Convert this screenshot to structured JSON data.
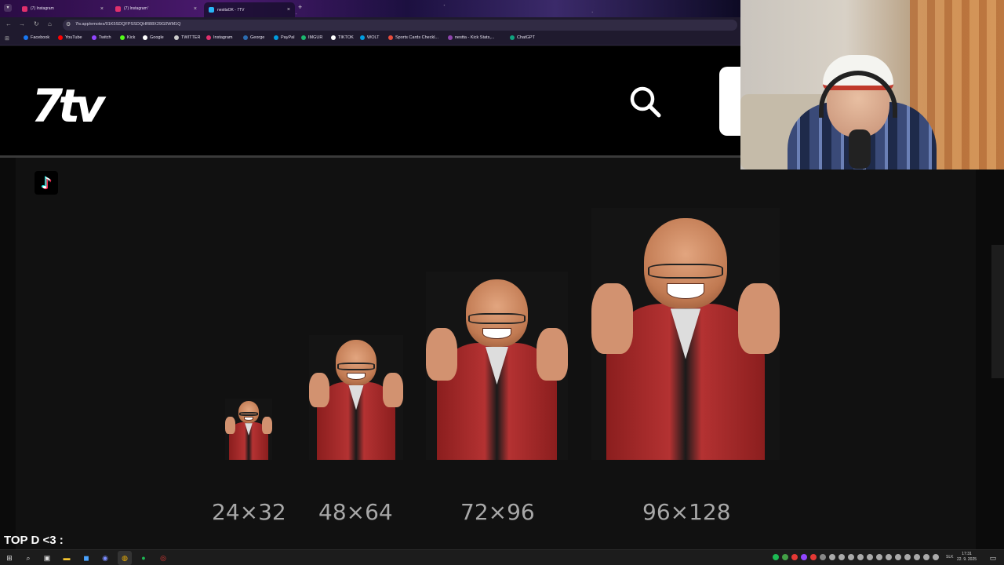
{
  "browser": {
    "tabs": [
      {
        "title": "(7) Instagram",
        "active": false
      },
      {
        "title": "(7) Instagram",
        "active": false
      },
      {
        "title": "nesttaOK - 7TV",
        "active": true
      }
    ],
    "url": "7tv.app/emotes/01K5SDQFPSSDQHR88X29G0WM1Q",
    "bookmarks": [
      {
        "label": "Facebook",
        "color": "#1877f2"
      },
      {
        "label": "YouTube",
        "color": "#ff0000"
      },
      {
        "label": "Twitch",
        "color": "#9146ff"
      },
      {
        "label": "Kick",
        "color": "#53fc18"
      },
      {
        "label": "Google",
        "color": "#ffffff"
      },
      {
        "label": "TWITTER",
        "color": "#cccccc"
      },
      {
        "label": "Instagram",
        "color": "#e1306c"
      },
      {
        "label": "George",
        "color": "#2b6cb0"
      },
      {
        "label": "PayPal",
        "color": "#009cde"
      },
      {
        "label": "IMGUR",
        "color": "#1bb76e"
      },
      {
        "label": "TIKTOK",
        "color": "#ffffff"
      },
      {
        "label": "WOLT",
        "color": "#009de0"
      },
      {
        "label": "Sports Cards Checkl...",
        "color": "#e74c3c"
      },
      {
        "label": "nestta - Kick Stats,...",
        "color": "#8e44ad"
      },
      {
        "label": "ChatGPT",
        "color": "#10a37f"
      }
    ]
  },
  "site": {
    "logo_text": "7tv"
  },
  "emotes": [
    {
      "size_label": "24×32"
    },
    {
      "size_label": "48×64"
    },
    {
      "size_label": "72×96"
    },
    {
      "size_label": "96×128"
    }
  ],
  "overlay": {
    "text": "TOP D <3 :"
  },
  "taskbar": {
    "language": "SLK",
    "time": "17:31",
    "date": "22. 9. 2025"
  }
}
